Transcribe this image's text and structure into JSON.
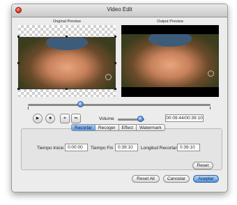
{
  "window": {
    "title": "Video Edit"
  },
  "preview": {
    "original_label": "Original Preview",
    "output_label": "Output Preview"
  },
  "controls": {
    "play_icon": "play-icon",
    "stop_icon": "stop-icon",
    "crop_icon": "crop-icon",
    "flip_icon": "flip-icon",
    "volume_label": "Volume",
    "volume_level_pct": 85,
    "seek_position_pct": 29,
    "time_display": "00:09:44/00:39:10"
  },
  "tabs": [
    {
      "label": "Recortar",
      "active": true
    },
    {
      "label": "Recoger",
      "active": false
    },
    {
      "label": "Effect",
      "active": false
    },
    {
      "label": "Watermark",
      "active": false
    }
  ],
  "trim": {
    "start_label": "Tiempo Inicio",
    "start_value": "0:00:00",
    "end_label": "Tiempo Fin",
    "end_value": "0:39:10",
    "length_label": "Longitud Recortar",
    "length_value": "0:39:10",
    "reset_label": "Reset"
  },
  "footer": {
    "reset_all_label": "Reset All",
    "cancel_label": "Cancelar",
    "accept_label": "Aceptar"
  },
  "colors": {
    "accent": "#4f92e0",
    "close": "#d2281a",
    "window_bg": "#ececec"
  }
}
